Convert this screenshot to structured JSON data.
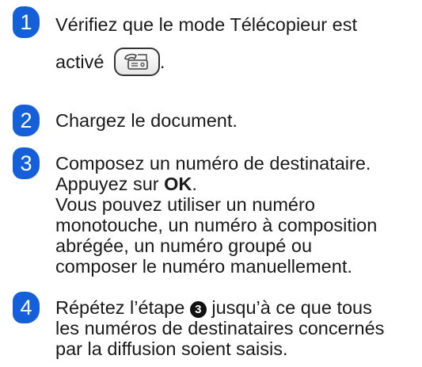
{
  "steps": [
    {
      "number": "1",
      "line1": "Vérifiez que le mode Télécopieur est",
      "line2": "activé",
      "line2_after": "."
    },
    {
      "number": "2",
      "line1": "Chargez le document."
    },
    {
      "number": "3",
      "line1": "Composez un numéro de destinataire.",
      "line2_prefix": "Appuyez sur ",
      "line2_bold": "OK",
      "line2_suffix": ".",
      "line3": "Vous pouvez utiliser un numéro",
      "line4": "monotouche, un numéro à composition",
      "line5": "abrégée, un numéro groupé ou",
      "line6": "composer le numéro manuellement."
    },
    {
      "number": "4",
      "line1_prefix": "Répétez l’étape ",
      "line1_ref": "3",
      "line1_suffix": " jusqu’à ce que tous",
      "line2": "les numéros de destinataires concernés",
      "line3": "par la diffusion soient saisis."
    }
  ],
  "icons": {
    "fax_mode_button": "fax-icon"
  },
  "colors": {
    "step_badge": "#1560d8",
    "text": "#1a1a1a"
  }
}
